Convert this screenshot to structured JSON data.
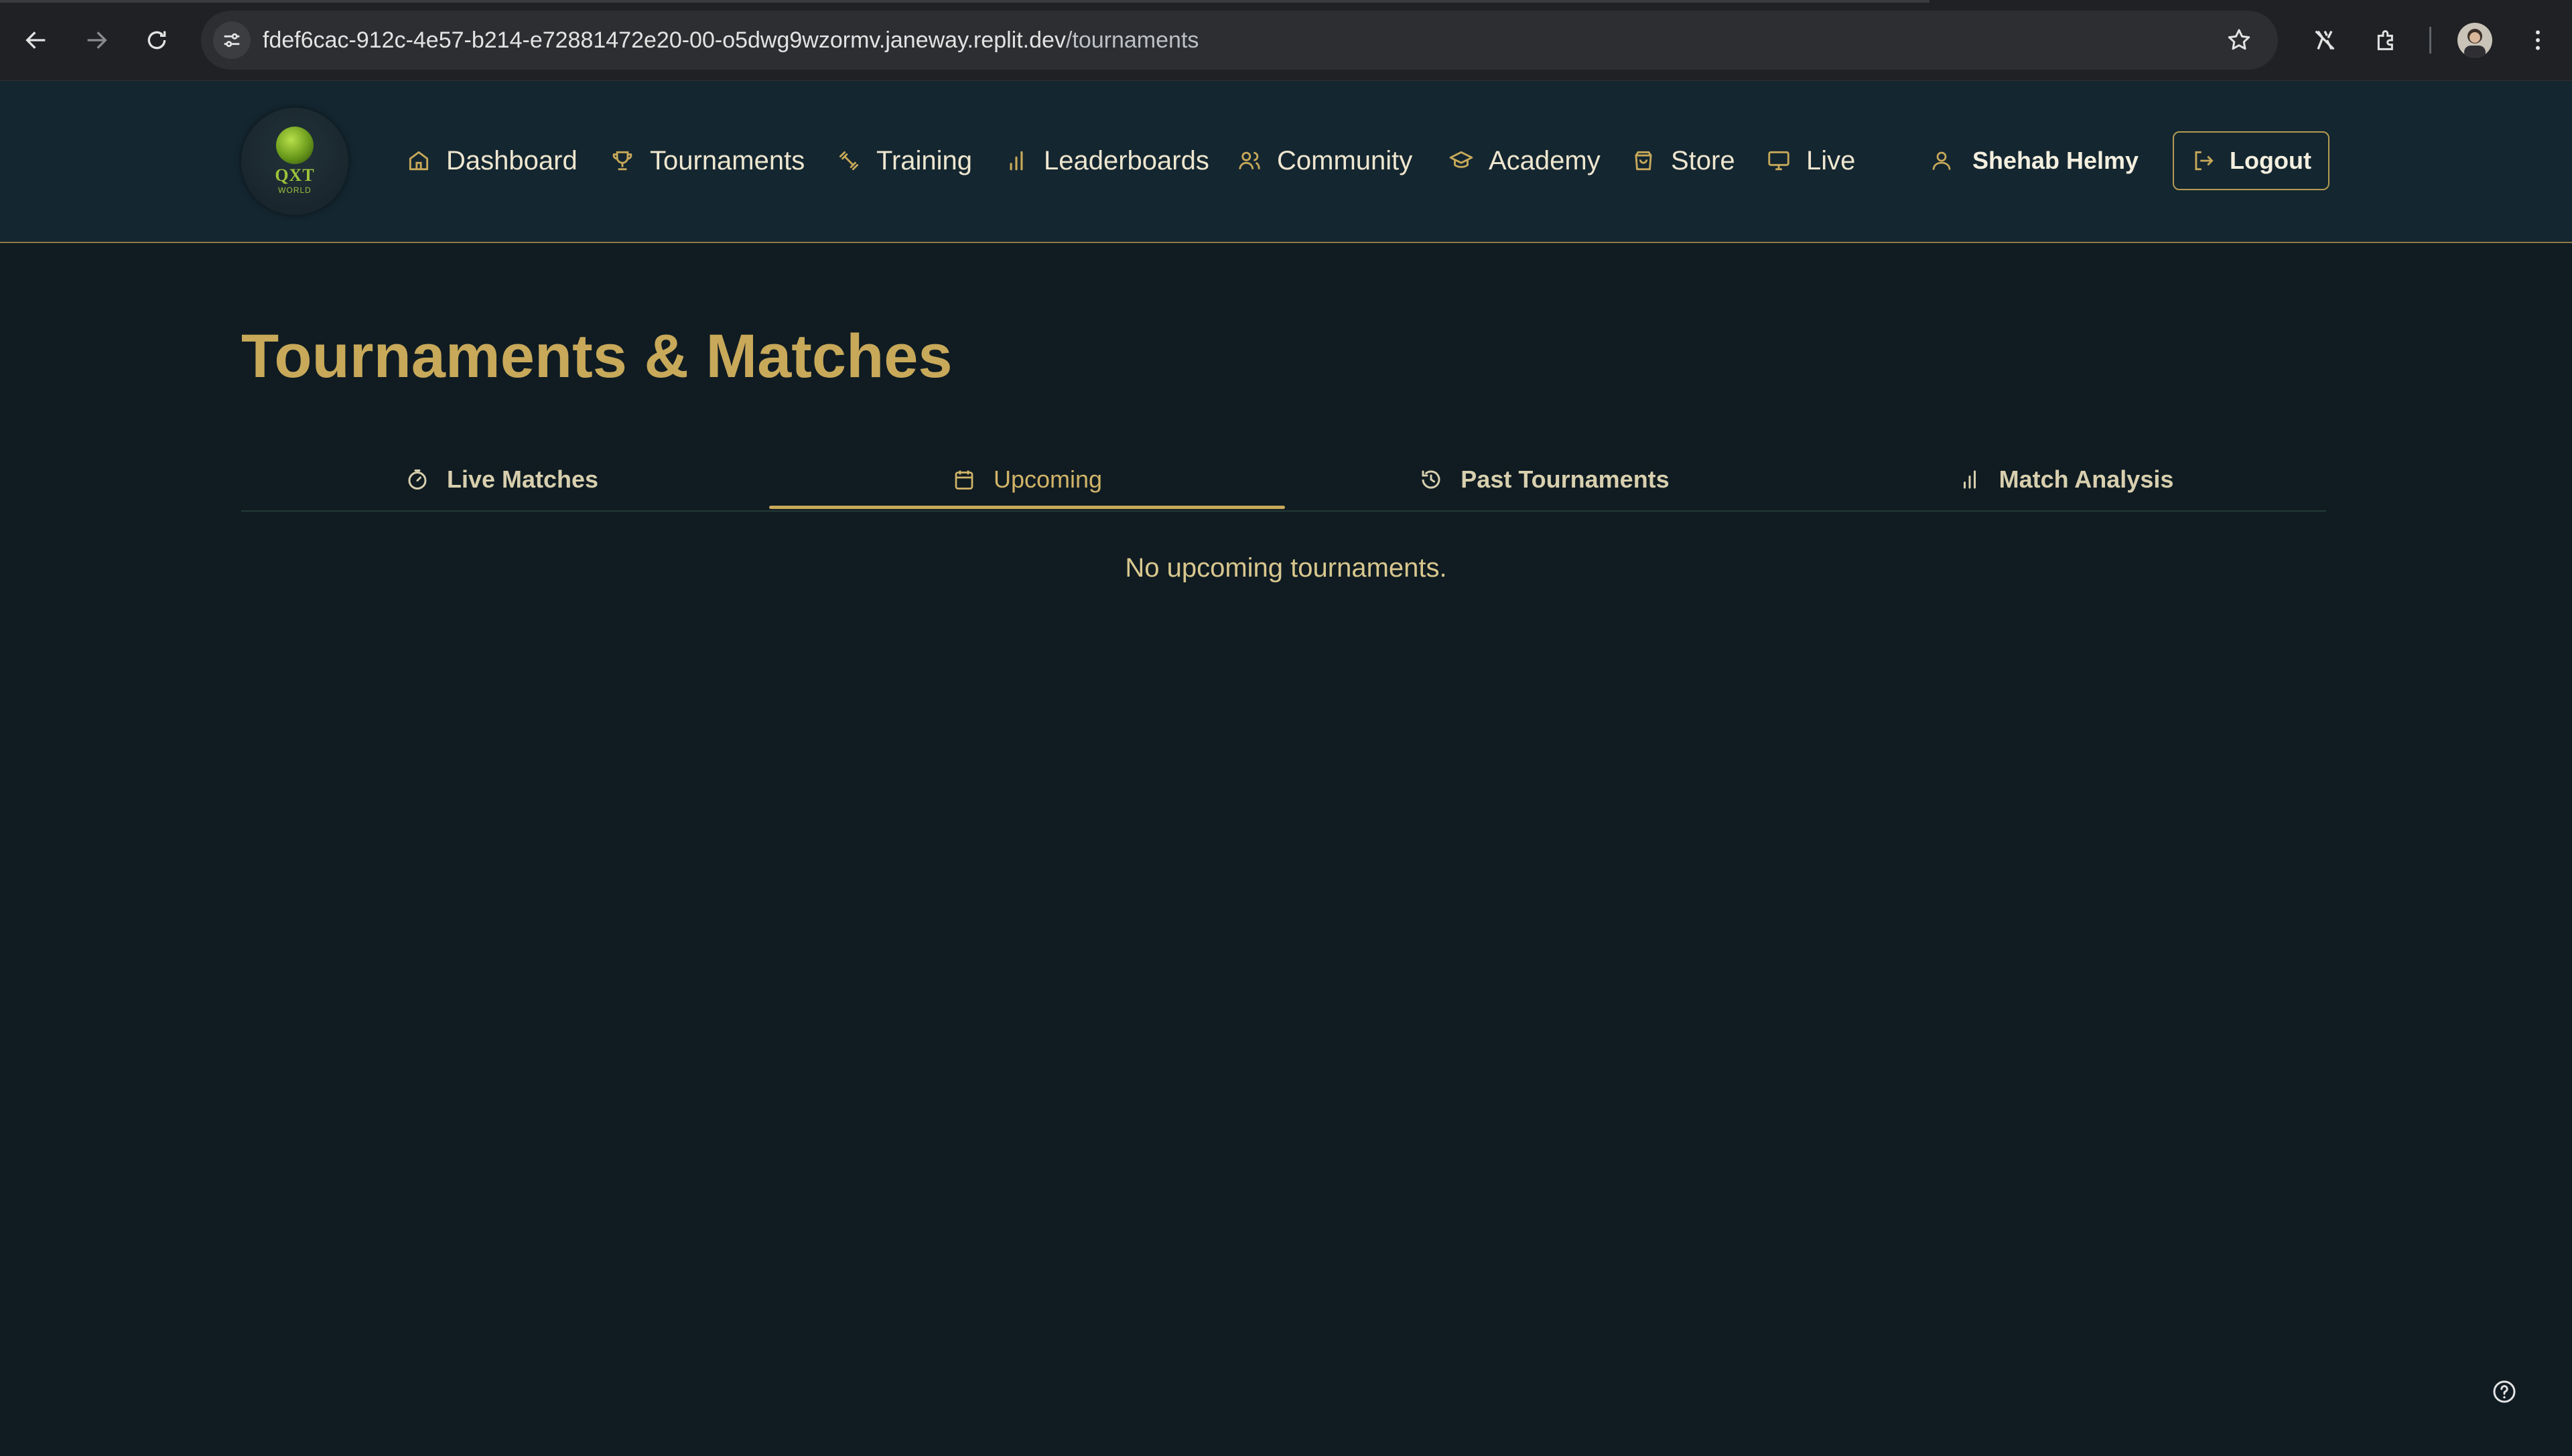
{
  "browser": {
    "url_host": "fdef6cac-912c-4e57-b214-e72881472e20-00-o5dwg9wzormv.janeway.replit.dev",
    "url_path": "/tournaments",
    "icons": [
      "back-icon",
      "forward-icon",
      "reload-icon",
      "site-settings-icon",
      "bookmark-star-icon",
      "extension-icon",
      "puzzle-icon",
      "profile-avatar",
      "more-menu-icon"
    ]
  },
  "brand": {
    "wordmark": "QXT",
    "subtitle": "WORLD"
  },
  "nav": {
    "items": [
      {
        "label": "Dashboard",
        "icon": "home-icon"
      },
      {
        "label": "Tournaments",
        "icon": "trophy-icon"
      },
      {
        "label": "Training",
        "icon": "dumbbell-icon"
      },
      {
        "label": "Leaderboards",
        "icon": "bar-chart-icon"
      },
      {
        "label": "Community",
        "icon": "users-icon"
      },
      {
        "label": "Academy",
        "icon": "graduation-cap-icon"
      },
      {
        "label": "Store",
        "icon": "shopping-bag-icon"
      },
      {
        "label": "Live",
        "icon": "monitor-icon"
      }
    ],
    "user_name": "Shehab Helmy",
    "logout_label": "Logout"
  },
  "page": {
    "title": "Tournaments & Matches",
    "tabs": [
      {
        "label": "Live Matches",
        "icon": "timer-icon",
        "active": false
      },
      {
        "label": "Upcoming",
        "icon": "calendar-icon",
        "active": true
      },
      {
        "label": "Past Tournaments",
        "icon": "history-icon",
        "active": false
      },
      {
        "label": "Match Analysis",
        "icon": "bar-chart-icon",
        "active": false
      }
    ],
    "empty_message": "No upcoming tournaments."
  },
  "colors": {
    "background": "#101c22",
    "header": "#142630",
    "accent_gold": "#c8a95a",
    "nav_text": "#eee6cf"
  }
}
